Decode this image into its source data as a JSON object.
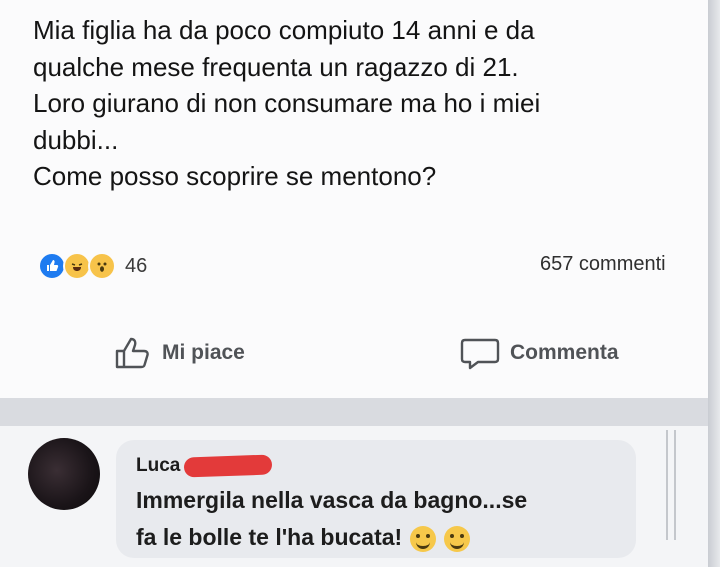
{
  "post": {
    "lines": [
      "Mia figlia ha da poco compiuto 14 anni e da",
      "qualche mese frequenta un ragazzo di 21.",
      "Loro giurano di non consumare ma ho i miei",
      "dubbi...",
      "Come posso scoprire se mentono?"
    ],
    "reaction_icons": [
      "like-icon",
      "haha-icon",
      "wow-icon"
    ],
    "reaction_count": "46",
    "comments_count": "657 commenti"
  },
  "actions": {
    "like_label": "Mi piace",
    "comment_label": "Commenta"
  },
  "comment": {
    "author": "Luca",
    "lines": [
      "Immergila nella vasca da bagno...se",
      "fa le bolle te l'ha bucata!"
    ]
  },
  "colors": {
    "like_blue": "#1e7bf0",
    "emoji_yellow": "#f6c84a",
    "redaction_red": "#e33a3a"
  }
}
